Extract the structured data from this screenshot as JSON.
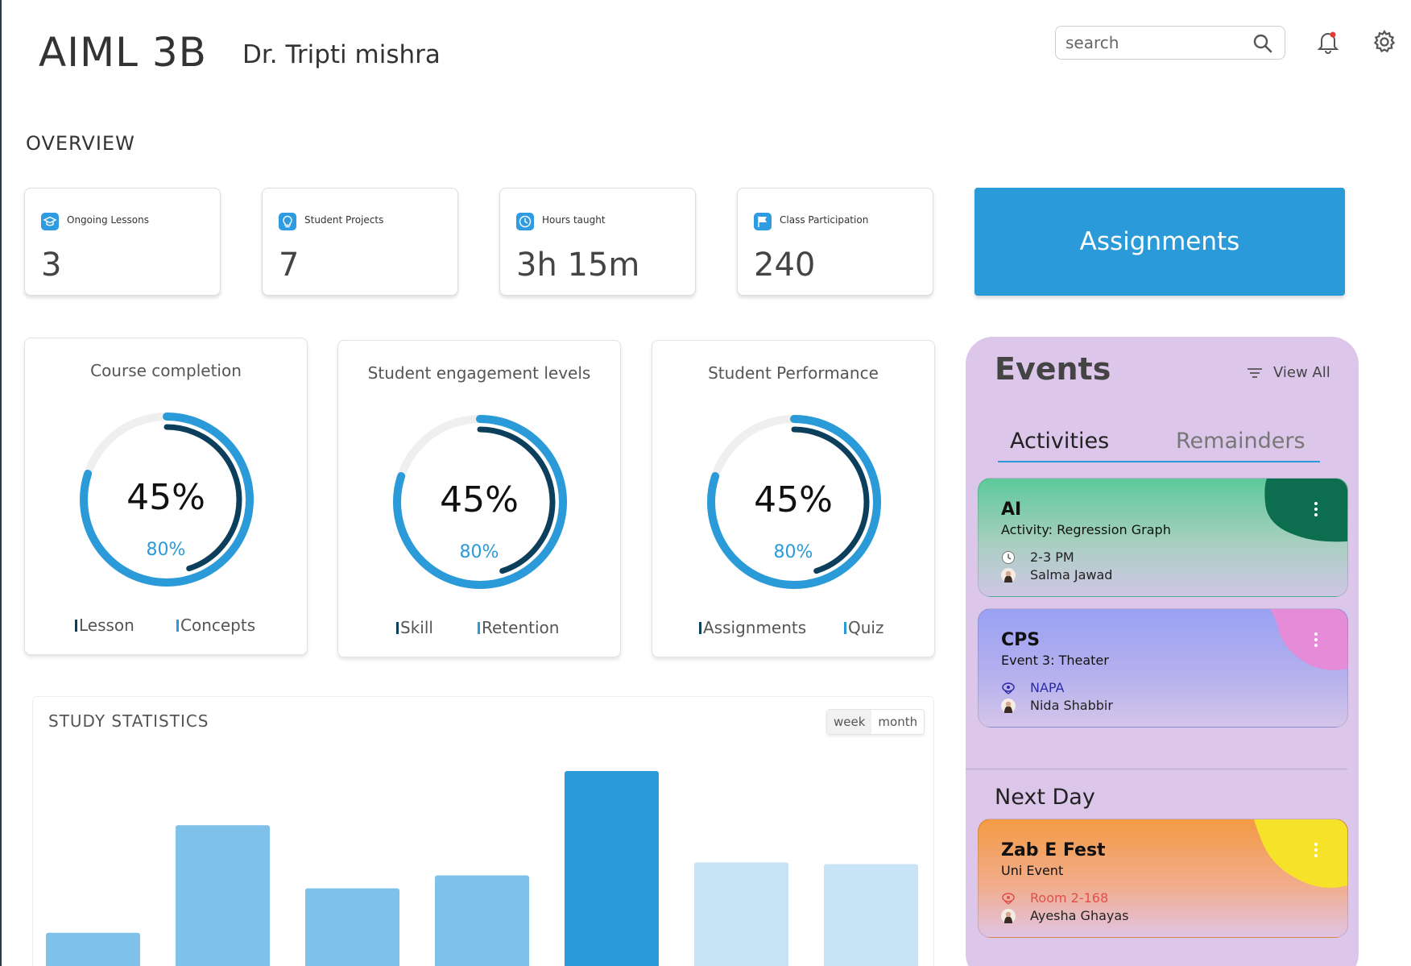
{
  "header": {
    "course": "AIML 3B",
    "teacher": "Dr. Tripti mishra",
    "search_placeholder": "search"
  },
  "overview": {
    "title": "OVERVIEW",
    "stats": [
      {
        "label": "Ongoing Lessons",
        "value": "3",
        "icon": "graduation-cap-icon"
      },
      {
        "label": "Student Projects",
        "value": "7",
        "icon": "lightbulb-icon"
      },
      {
        "label": "Hours taught",
        "value": "3h 15m",
        "icon": "clock-icon"
      },
      {
        "label": "Class Participation",
        "value": "240",
        "icon": "flag-icon"
      }
    ],
    "assignments_label": "Assignments"
  },
  "rings": [
    {
      "title": "Course completion",
      "main": "45%",
      "sub": "80%",
      "outer_progress": 0.8,
      "inner_progress": 0.45,
      "legend": [
        "Lesson",
        "Concepts"
      ]
    },
    {
      "title": "Student engagement levels",
      "main": "45%",
      "sub": "80%",
      "outer_progress": 0.8,
      "inner_progress": 0.45,
      "legend": [
        "Skill",
        "Retention"
      ]
    },
    {
      "title": "Student Performance",
      "main": "45%",
      "sub": "80%",
      "outer_progress": 0.8,
      "inner_progress": 0.45,
      "legend": [
        "Assignments",
        "Quiz"
      ]
    }
  ],
  "colors": {
    "accent": "#2b9ad8",
    "dark_ring": "#0b3f5c",
    "events_bg": "#dcc6ea",
    "bar_mid": "#7fc1e8",
    "bar_light": "#c8e3f5",
    "bar_dark": "#2b9ad8"
  },
  "study_statistics": {
    "title": "STUDY STATISTICS",
    "toggle": [
      "week",
      "month"
    ],
    "selected": "week"
  },
  "chart_data": {
    "type": "bar",
    "values": [
      57,
      190,
      112,
      128,
      257,
      144,
      142
    ],
    "emphasis": [
      "mid",
      "mid",
      "mid",
      "mid",
      "dark",
      "light",
      "light"
    ]
  },
  "events": {
    "title": "Events",
    "view_all": "View All",
    "tabs": [
      "Activities",
      "Remainders"
    ],
    "active_tab": "Activities",
    "next_day_label": "Next Day",
    "items": [
      {
        "title": "AI",
        "subtitle": "Activity: Regression Graph",
        "detail": "2-3 PM",
        "detail_icon": "clock-icon",
        "person": "Salma Jawad"
      },
      {
        "title": "CPS",
        "subtitle": "Event 3: Theater",
        "detail": "NAPA",
        "detail_icon": "location-icon",
        "person": "Nida Shabbir"
      },
      {
        "title": "Zab E Fest",
        "subtitle": "Uni Event",
        "detail": "Room 2-168",
        "detail_icon": "location-icon",
        "person": "Ayesha Ghayas"
      }
    ]
  }
}
